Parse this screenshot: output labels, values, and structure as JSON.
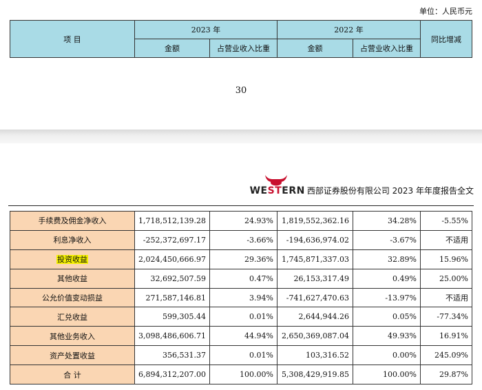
{
  "unit_note": "单位：人民币元",
  "header": {
    "item": "项 目",
    "year_2023": "2023 年",
    "year_2022": "2022 年",
    "amount": "金额",
    "share": "占营业收入比重",
    "yoy": "同比增减"
  },
  "page_number": "30",
  "brand": {
    "logo_we": "WE",
    "logo_st": "ST",
    "logo_ern": "ERN",
    "doc_title": "西部证券股份有限公司 2023 年年度报告全文"
  },
  "rows": [
    {
      "label": "手续费及佣金净收入",
      "amount_2023": "1,718,512,139.28",
      "share_2023": "24.93%",
      "amount_2022": "1,819,552,362.16",
      "share_2022": "34.28%",
      "yoy": "-5.55%"
    },
    {
      "label": "利息净收入",
      "amount_2023": "-252,372,697.17",
      "share_2023": "-3.66%",
      "amount_2022": "-194,636,974.02",
      "share_2022": "-3.67%",
      "yoy": "不适用"
    },
    {
      "label": "投资收益",
      "amount_2023": "2,024,450,666.97",
      "share_2023": "29.36%",
      "amount_2022": "1,745,871,337.03",
      "share_2022": "32.89%",
      "yoy": "15.96%"
    },
    {
      "label": "其他收益",
      "amount_2023": "32,692,507.59",
      "share_2023": "0.47%",
      "amount_2022": "26,153,317.49",
      "share_2022": "0.49%",
      "yoy": "25.00%"
    },
    {
      "label": "公允价值变动损益",
      "amount_2023": "271,587,146.81",
      "share_2023": "3.94%",
      "amount_2022": "-741,627,470.63",
      "share_2022": "-13.97%",
      "yoy": "不适用"
    },
    {
      "label": "汇兑收益",
      "amount_2023": "599,305.44",
      "share_2023": "0.01%",
      "amount_2022": "2,644,944.26",
      "share_2022": "0.05%",
      "yoy": "-77.34%"
    },
    {
      "label": "其他业务收入",
      "amount_2023": "3,098,486,606.71",
      "share_2023": "44.94%",
      "amount_2022": "2,650,369,087.04",
      "share_2022": "49.93%",
      "yoy": "16.91%"
    },
    {
      "label": "资产处置收益",
      "amount_2023": "356,531.37",
      "share_2023": "0.01%",
      "amount_2022": "103,316.52",
      "share_2022": "0.00%",
      "yoy": "245.09%"
    },
    {
      "label": "合 计",
      "amount_2023": "6,894,312,207.00",
      "share_2023": "100.00%",
      "amount_2022": "5,308,429,919.85",
      "share_2022": "100.00%",
      "yoy": "29.87%"
    }
  ],
  "colors": {
    "header_bg": "#a9dbe6",
    "label_bg": "#fad6b3",
    "highlight": "#f4f000",
    "logo_red": "#c8102e"
  }
}
